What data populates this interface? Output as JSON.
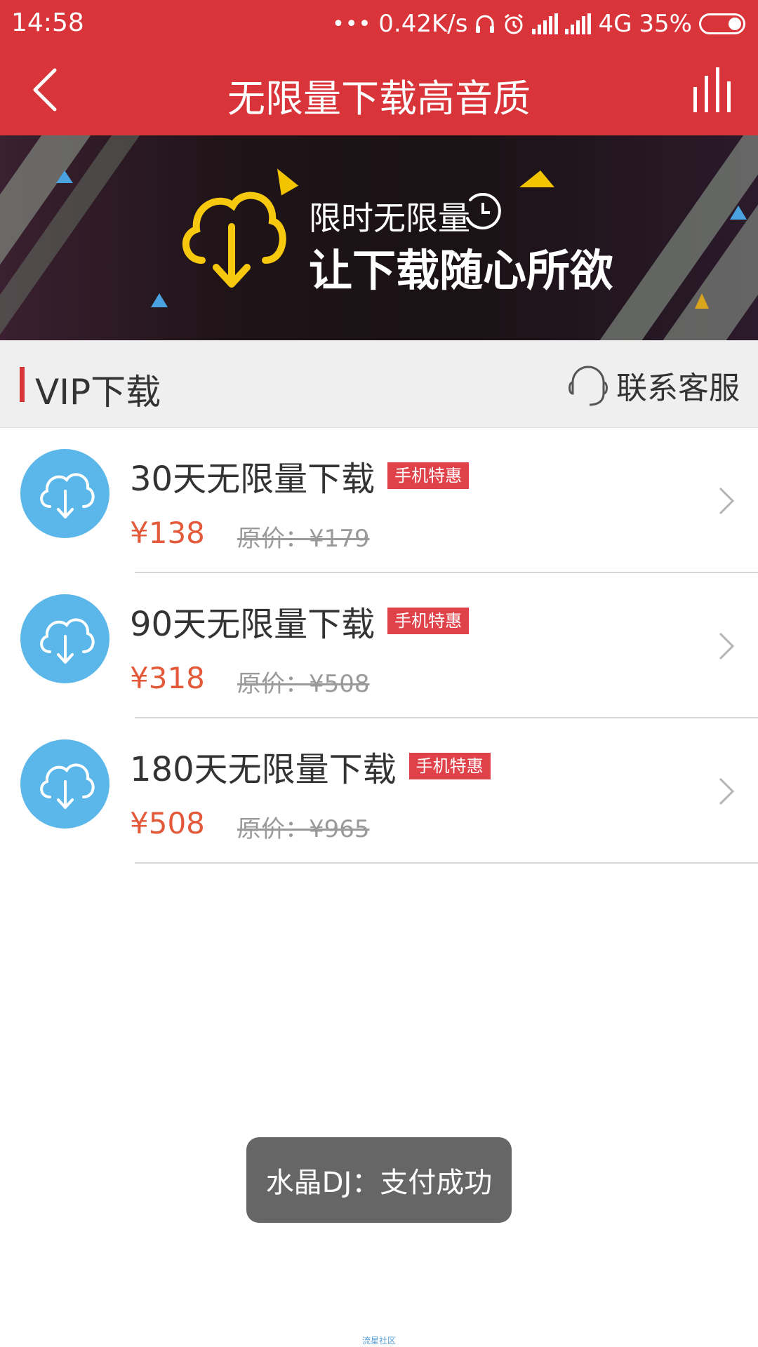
{
  "status_bar": {
    "time": "14:58",
    "network_speed": "0.42K/s",
    "network_type": "4G",
    "battery": "35%"
  },
  "title_bar": {
    "title": "无限量下载高音质",
    "back_icon": "chevron-left-icon",
    "chart_icon": "bars-chart-icon"
  },
  "banner": {
    "line1": "限时无限量",
    "line2": "让下载随心所欲"
  },
  "section": {
    "title": "VIP下载",
    "contact_label": "联系客服"
  },
  "products": [
    {
      "name": "30天无限量下载",
      "badge": "手机特惠",
      "price": "¥138",
      "original_price": "原价：¥179"
    },
    {
      "name": "90天无限量下载",
      "badge": "手机特惠",
      "price": "¥318",
      "original_price": "原价：¥508"
    },
    {
      "name": "180天无限量下载",
      "badge": "手机特惠",
      "price": "¥508",
      "original_price": "原价：¥965"
    }
  ],
  "toast": {
    "message": "水晶DJ：支付成功"
  },
  "footer": {
    "watermark": "流星社区"
  },
  "colors": {
    "accent_red": "#d8343a",
    "price_orange": "#e35a3a",
    "icon_blue": "#5bb7e9",
    "badge_red": "#e0424a"
  }
}
